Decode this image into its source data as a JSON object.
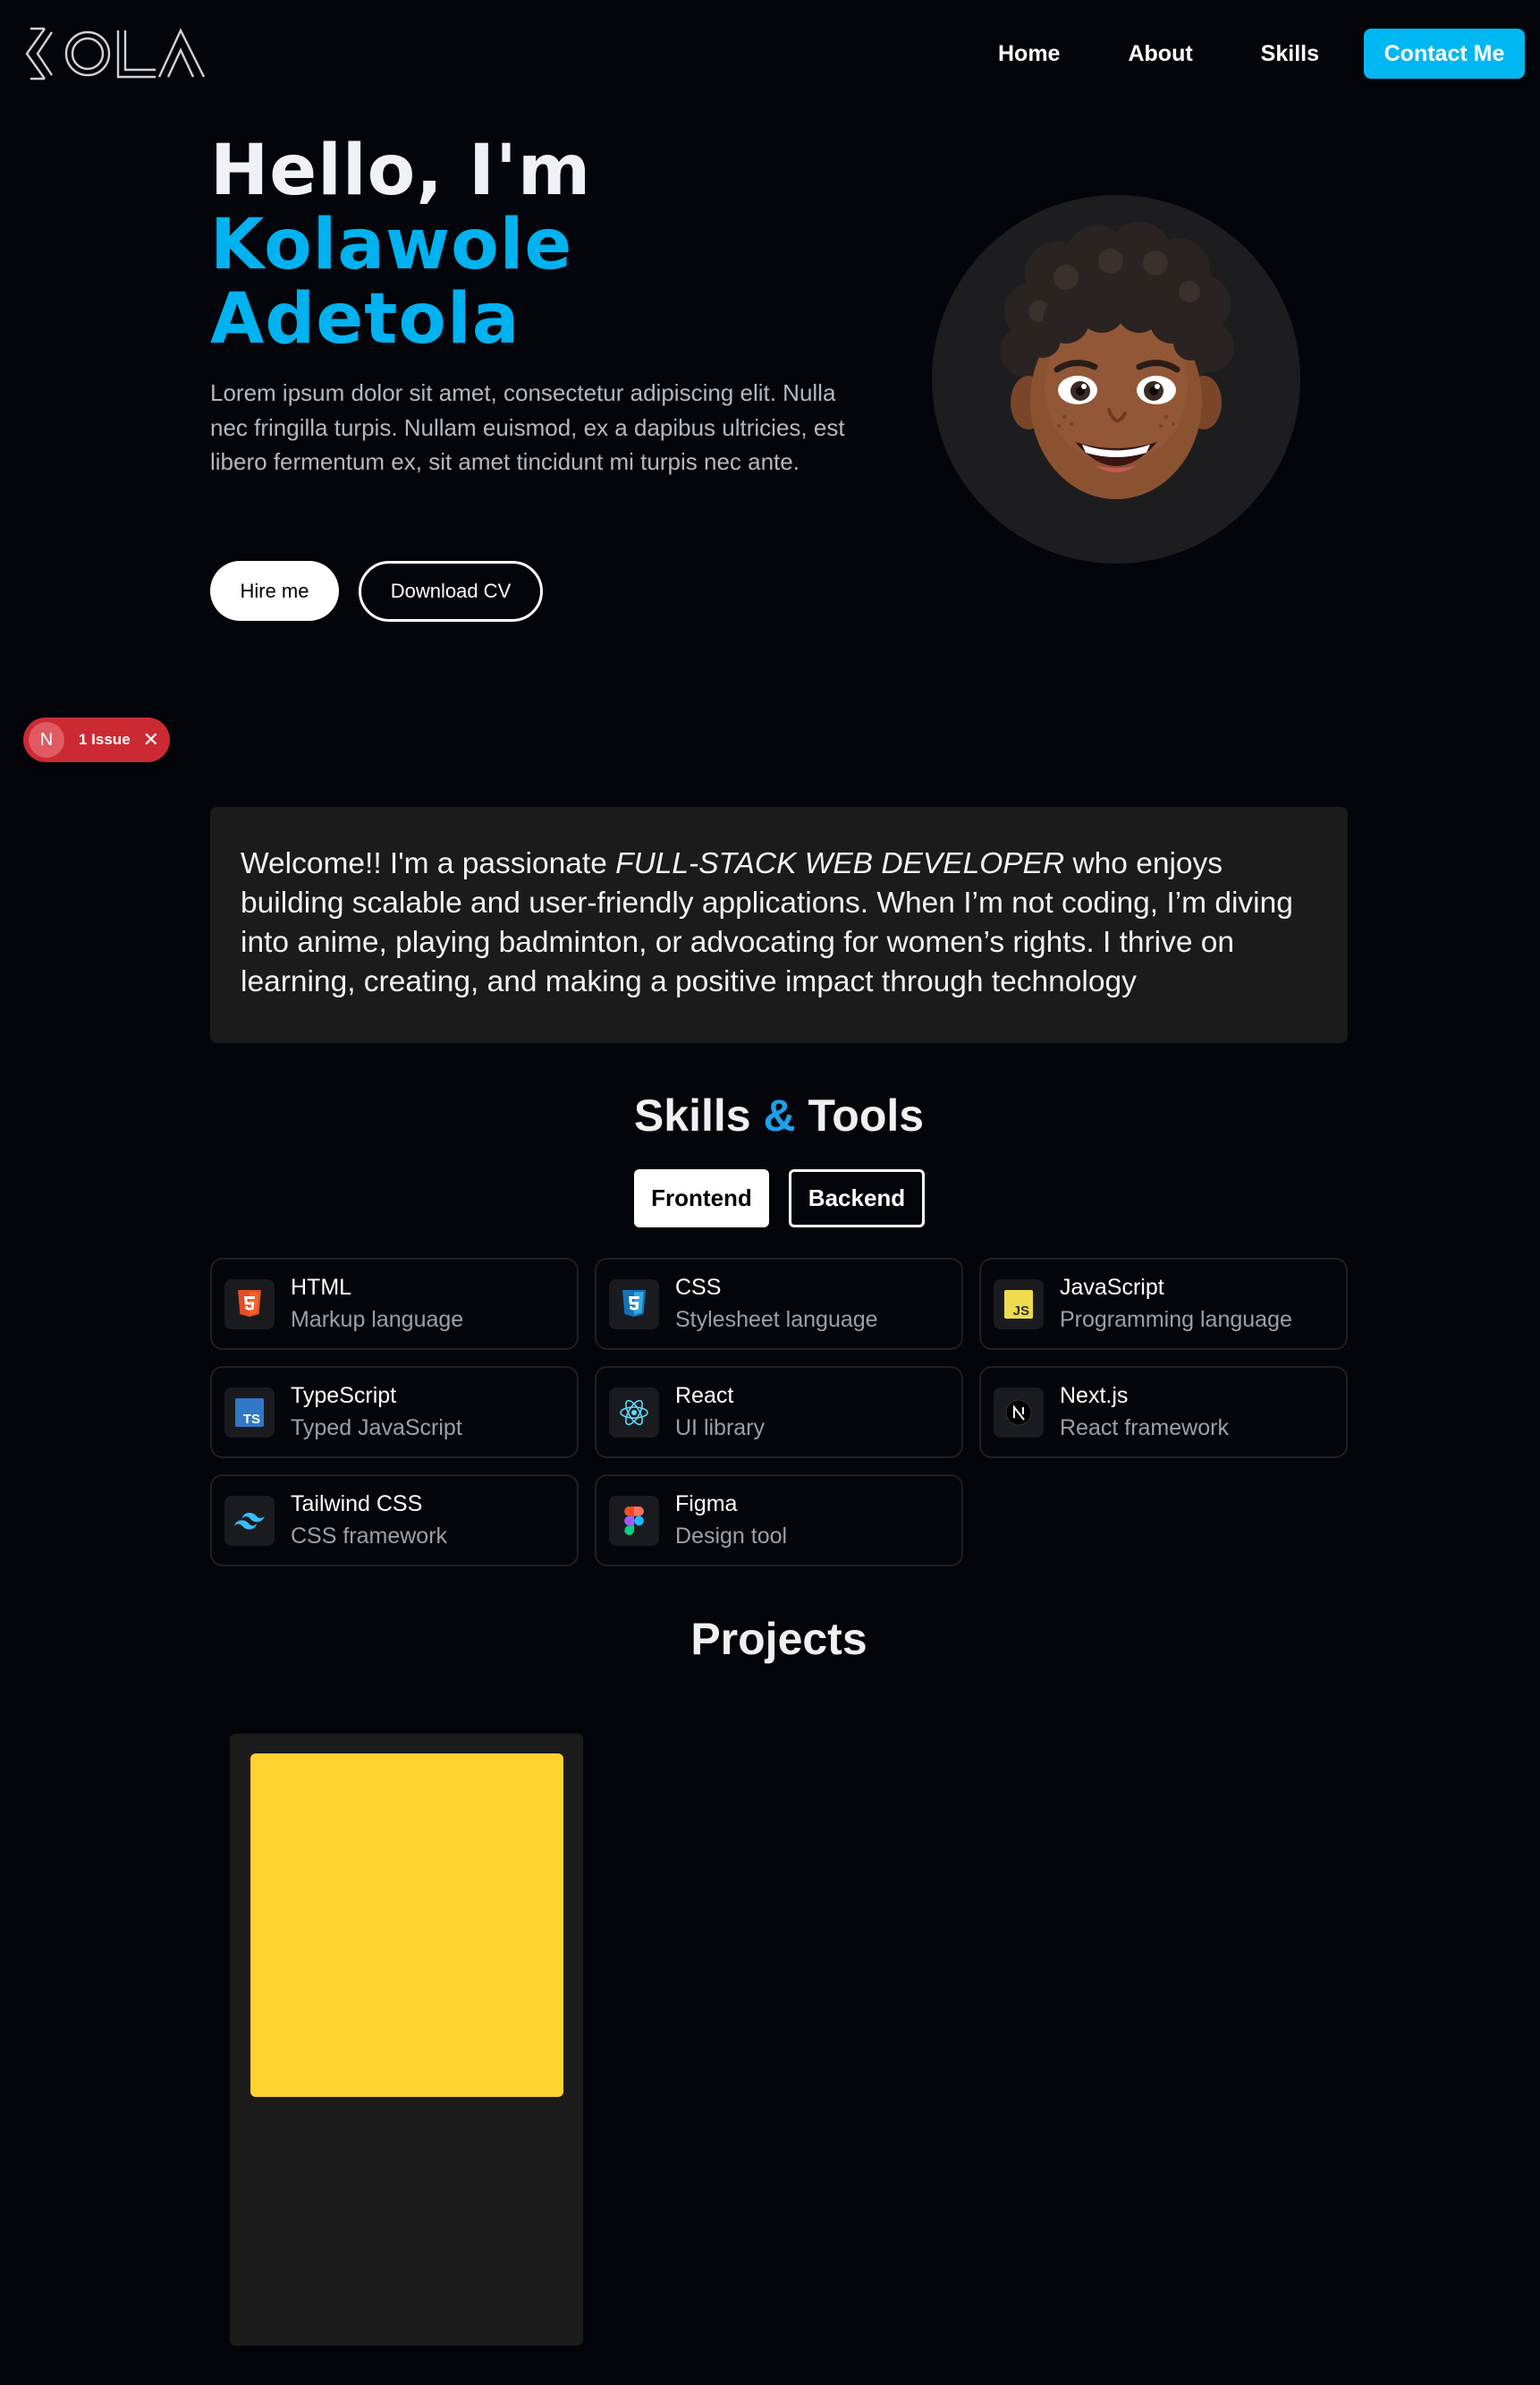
{
  "brand": {
    "logo_text": "KOLA",
    "logo_icon": "kola-logo-icon"
  },
  "nav": {
    "links": [
      "Home",
      "About",
      "Skills"
    ],
    "contact_label": "Contact Me"
  },
  "hero": {
    "greeting": "Hello, I'm",
    "first_name": "Kolawole",
    "last_name": "Adetola",
    "description": "Lorem ipsum dolor sit amet, consectetur adipiscing elit. Nulla nec fringilla turpis. Nullam euismod, ex a dapibus ultricies, est libero fermentum ex, sit amet tincidunt mi turpis nec ante.",
    "hire_label": "Hire me",
    "cv_label": "Download CV",
    "avatar_icon": "memoji-avatar-icon"
  },
  "issue_badge": {
    "letter": "N",
    "label": "1 Issue",
    "close": "✕"
  },
  "about": {
    "text_before": "Welcome!! I'm a passionate ",
    "emphasis": "FULL-STACK WEB DEVELOPER",
    "text_after": " who enjoys building scalable and user-friendly applications. When I’m not coding, I’m diving into anime, playing badminton, or advocating for women’s rights. I thrive on learning, creating, and making a positive impact through technology"
  },
  "skills": {
    "title_part1": "Skills ",
    "title_amp": "&",
    "title_part2": " Tools",
    "tabs": [
      "Frontend",
      "Backend"
    ],
    "items": [
      {
        "name": "HTML",
        "desc": "Markup language",
        "icon": "html5-icon"
      },
      {
        "name": "CSS",
        "desc": "Stylesheet language",
        "icon": "css3-icon"
      },
      {
        "name": "JavaScript",
        "desc": "Programming language",
        "icon": "javascript-icon"
      },
      {
        "name": "TypeScript",
        "desc": "Typed JavaScript",
        "icon": "typescript-icon"
      },
      {
        "name": "React",
        "desc": "UI library",
        "icon": "react-icon"
      },
      {
        "name": "Next.js",
        "desc": "React framework",
        "icon": "nextjs-icon"
      },
      {
        "name": "Tailwind CSS",
        "desc": "CSS framework",
        "icon": "tailwind-icon"
      },
      {
        "name": "Figma",
        "desc": "Design tool",
        "icon": "figma-icon"
      }
    ]
  },
  "projects": {
    "title": "Projects"
  },
  "colors": {
    "background": "#03050b",
    "accent": "#00b2ef",
    "card": "#1b1b1c",
    "issue_red": "#cc2a33",
    "project_thumb": "#ffd22e"
  }
}
